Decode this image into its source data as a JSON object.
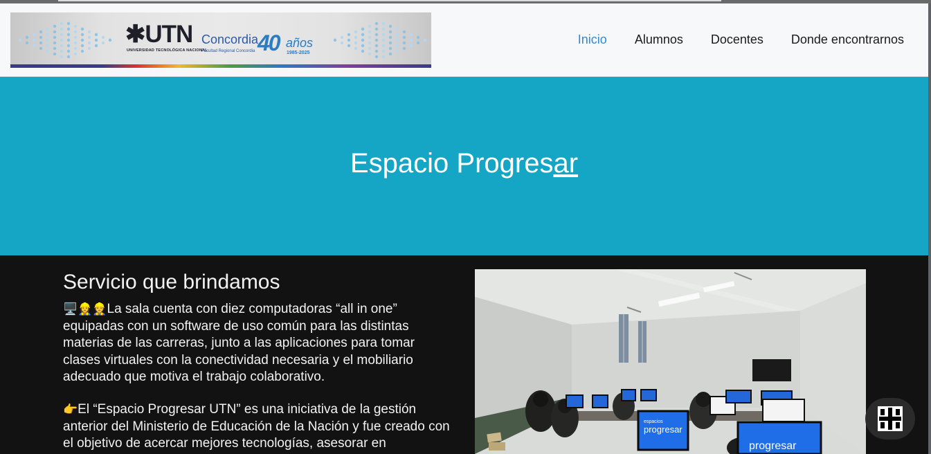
{
  "logo": {
    "mark": "✱UTN",
    "sub": "UNIVERSIDAD TECNOLÓGICA NACIONAL",
    "city": "Concordia",
    "city_sub": "Facultad Regional Concordia",
    "anniversary": "40",
    "anniversary_word": "años",
    "years": "1985-2025"
  },
  "nav": {
    "items": [
      {
        "label": "Inicio",
        "active": true
      },
      {
        "label": "Alumnos",
        "active": false
      },
      {
        "label": "Docentes",
        "active": false
      },
      {
        "label": "Donde encontrarnos",
        "active": false
      }
    ]
  },
  "hero": {
    "title_part1": "Espacio Progres",
    "title_part2": "ar"
  },
  "content": {
    "section_title": "Servicio que brindamos",
    "p1_emoji": "🖥️👷‍♀️👷",
    "p1_text": "La sala cuenta con diez computadoras “all in one” equipadas con un software de uso común para las distintas materias de las carreras, junto a las aplicaciones para tomar clases virtuales con la conectividad necesaria y el mobiliario adecuado que motiva el trabajo colaborativo.",
    "p2_emoji": "👉",
    "p2_text": "El “Espacio Progresar UTN” es una iniciativa de la gestión anterior del Ministerio de Educación de la Nación y fue creado con el objetivo de acercar mejores tecnologías, asesorar en",
    "photo_screen_text": "progresar",
    "photo_screen_small": "espacios"
  },
  "colors": {
    "hero_bg": "#15a6c5",
    "content_bg": "#121212",
    "nav_active": "#2f8ad4"
  }
}
